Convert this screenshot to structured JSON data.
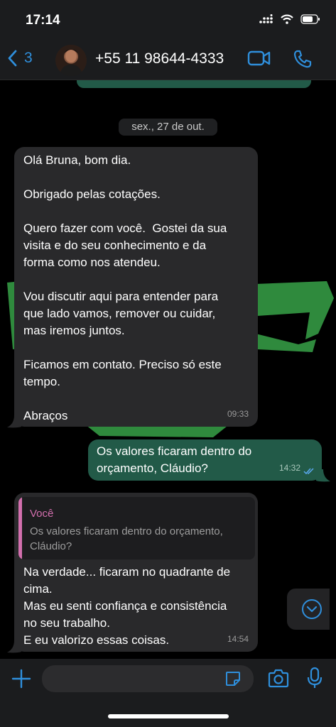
{
  "status": {
    "time": "17:14",
    "icons": [
      "signal-icon",
      "wifi-icon",
      "battery-icon"
    ]
  },
  "header": {
    "back_count": "3",
    "contact": "+55 11 98644-4333",
    "icons": [
      "chevron-left-icon",
      "video-call-icon",
      "phone-call-icon"
    ]
  },
  "colors": {
    "accent": "#2f8fdc",
    "outgoing_bubble": "#225a48",
    "incoming_bubble": "#29292b",
    "quote_author": "#d36fae",
    "wallpaper_green": "#2f8a3d"
  },
  "chat": {
    "date_label": "sex., 27 de out.",
    "messages": [
      {
        "direction": "in",
        "text": "Olá Bruna, bom dia.\n\nObrigado pelas cotações.\n\nQuero fazer com você.  Gostei da sua\nvisita e do seu conhecimento e da\nforma como nos atendeu.\n\nVou discutir aqui para entender para\nque lado vamos, remover ou cuidar,\nmas iremos juntos.\n\nFicamos em contato. Preciso só este\ntempo.\n\nAbraços",
        "time": "09:33"
      },
      {
        "direction": "out",
        "text": "Os valores ficaram dentro do\norçamento, Cláudio?",
        "time": "14:32",
        "status": "read"
      },
      {
        "direction": "in",
        "quote_author": "Você",
        "quote_text": "Os valores ficaram dentro do orçamento,\nCláudio?",
        "text": "Na verdade... ficaram no quadrante de\ncima.\nMas eu senti confiança e consistência\nno seu trabalho.\nE eu valorizo essas coisas.",
        "time": "14:54"
      }
    ]
  },
  "input": {
    "placeholder": "",
    "icons": [
      "plus-icon",
      "sticker-icon",
      "camera-icon",
      "microphone-icon"
    ]
  }
}
